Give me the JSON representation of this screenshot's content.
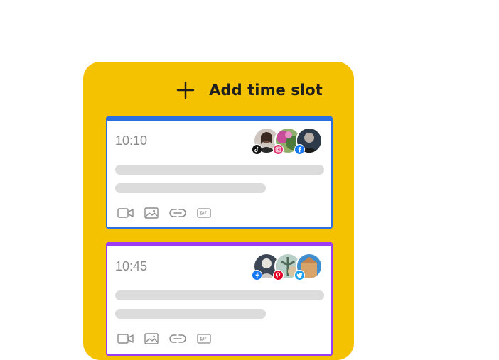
{
  "add_slot": {
    "label": "Add time slot",
    "icon": "plus-icon"
  },
  "colors": {
    "panel": "#f5c200",
    "card1_accent": "#2b6fe0",
    "card2_accent": "#9b3df2",
    "tiktok": "#111111",
    "instagram": "#e1306c",
    "facebook": "#1877f2",
    "pinterest": "#e60023",
    "twitter": "#1da1f2"
  },
  "slots": [
    {
      "time": "10:10",
      "accounts": [
        "tiktok",
        "instagram",
        "facebook"
      ],
      "tools": [
        "video-icon",
        "image-icon",
        "link-icon",
        "gif-icon"
      ]
    },
    {
      "time": "10:45",
      "accounts": [
        "facebook",
        "pinterest",
        "twitter"
      ],
      "tools": [
        "video-icon",
        "image-icon",
        "link-icon",
        "gif-icon"
      ]
    }
  ]
}
